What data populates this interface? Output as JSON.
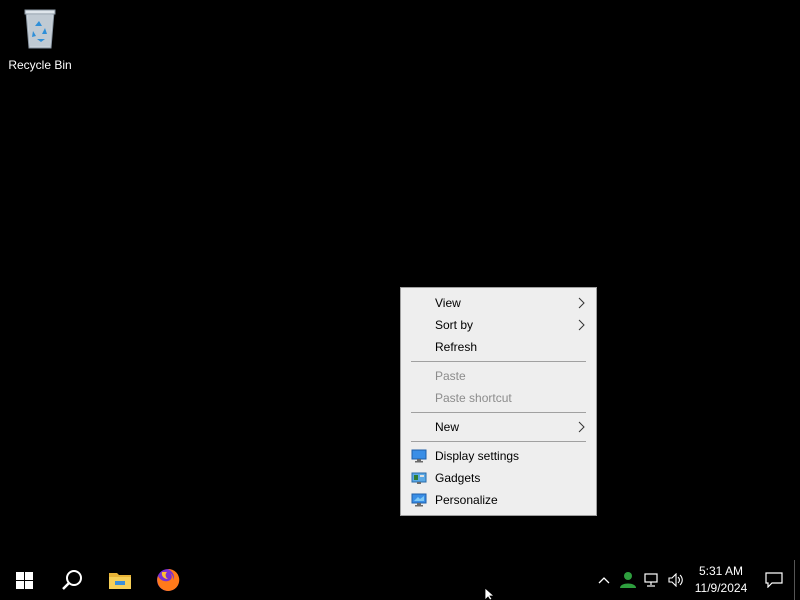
{
  "desktop": {
    "icons": [
      {
        "label": "Recycle Bin",
        "icon": "recycle-bin-icon"
      }
    ]
  },
  "context_menu": {
    "items": [
      {
        "label": "View",
        "submenu": true,
        "disabled": false
      },
      {
        "label": "Sort by",
        "submenu": true,
        "disabled": false
      },
      {
        "label": "Refresh",
        "submenu": false,
        "disabled": false
      },
      {
        "label": "Paste",
        "submenu": false,
        "disabled": true
      },
      {
        "label": "Paste shortcut",
        "submenu": false,
        "disabled": true
      },
      {
        "label": "New",
        "submenu": true,
        "disabled": false
      },
      {
        "label": "Display settings",
        "icon": "display-settings-icon"
      },
      {
        "label": "Gadgets",
        "icon": "gadgets-icon"
      },
      {
        "label": "Personalize",
        "icon": "personalize-icon"
      }
    ]
  },
  "taskbar": {
    "pinned": [
      "start-icon",
      "search-icon",
      "file-explorer-icon",
      "firefox-icon"
    ],
    "tray_icons": [
      "chevron-up-icon",
      "user-status-icon",
      "network-icon",
      "volume-icon"
    ],
    "clock": {
      "time": "5:31 AM",
      "date": "11/9/2024"
    },
    "notification_icon": "notification-icon"
  },
  "colors": {
    "desktop_bg": "#000000",
    "menu_bg": "#eeeeee",
    "menu_disabled_text": "#8c8c8c"
  }
}
